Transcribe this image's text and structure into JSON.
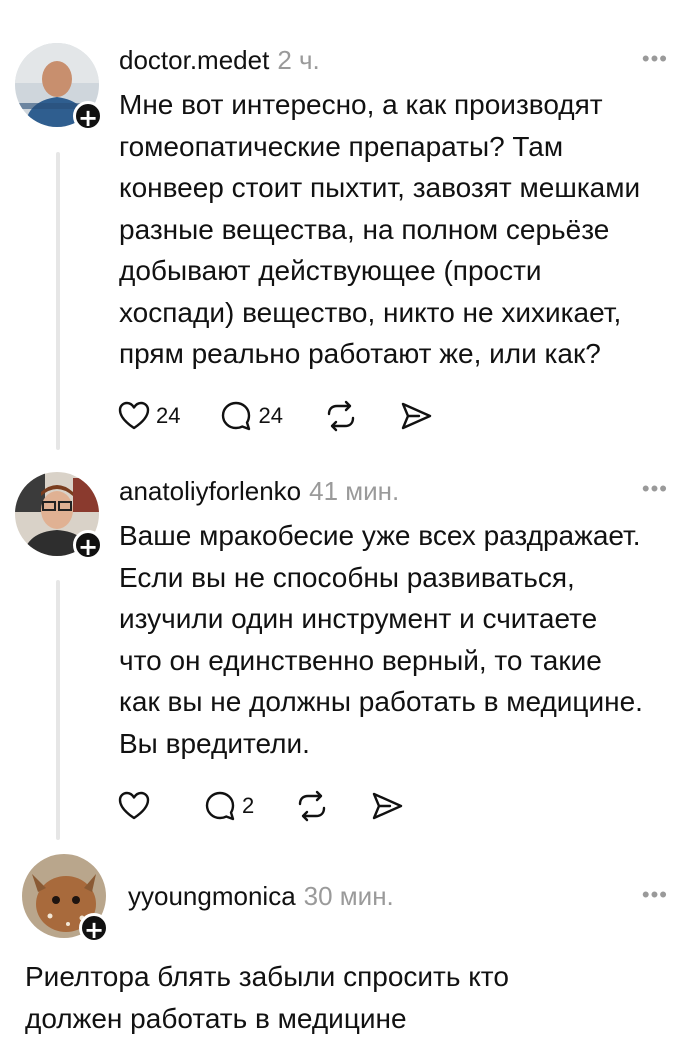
{
  "comments": [
    {
      "username": "doctor.medet",
      "time": "2 ч.",
      "text": "Мне вот интересно, а как производят\nгомеопатические препараты? Там\nконвеер стоит пыхтит, завозят мешками\nразные вещества, на полном серьёзе\nдобывают действующее (прости\nхоспади) вещество, никто не хихикает,\nпрям реально работают же, или как?",
      "likes": "24",
      "replies": "24"
    },
    {
      "username": "anatoliyforlenko",
      "time": "41 мин.",
      "text": "Ваше мракобесие уже всех раздражает.\nЕсли вы не способны развиваться,\nизучили один инструмент и считаете\nчто он единственно верный, то такие\nкак вы не должны работать в медицине.\nВы вредители.",
      "likes": "",
      "replies": "2"
    },
    {
      "username": "yyoungmonica",
      "time": "30 мин.",
      "text": "Риелтора блять забыли спросить кто\nдолжен работать в медицине"
    }
  ],
  "icons": {
    "more": "more-dots-icon",
    "like": "heart-icon",
    "reply": "comment-bubble-icon",
    "repost": "repost-icon",
    "share": "share-send-icon",
    "follow": "plus-icon"
  }
}
